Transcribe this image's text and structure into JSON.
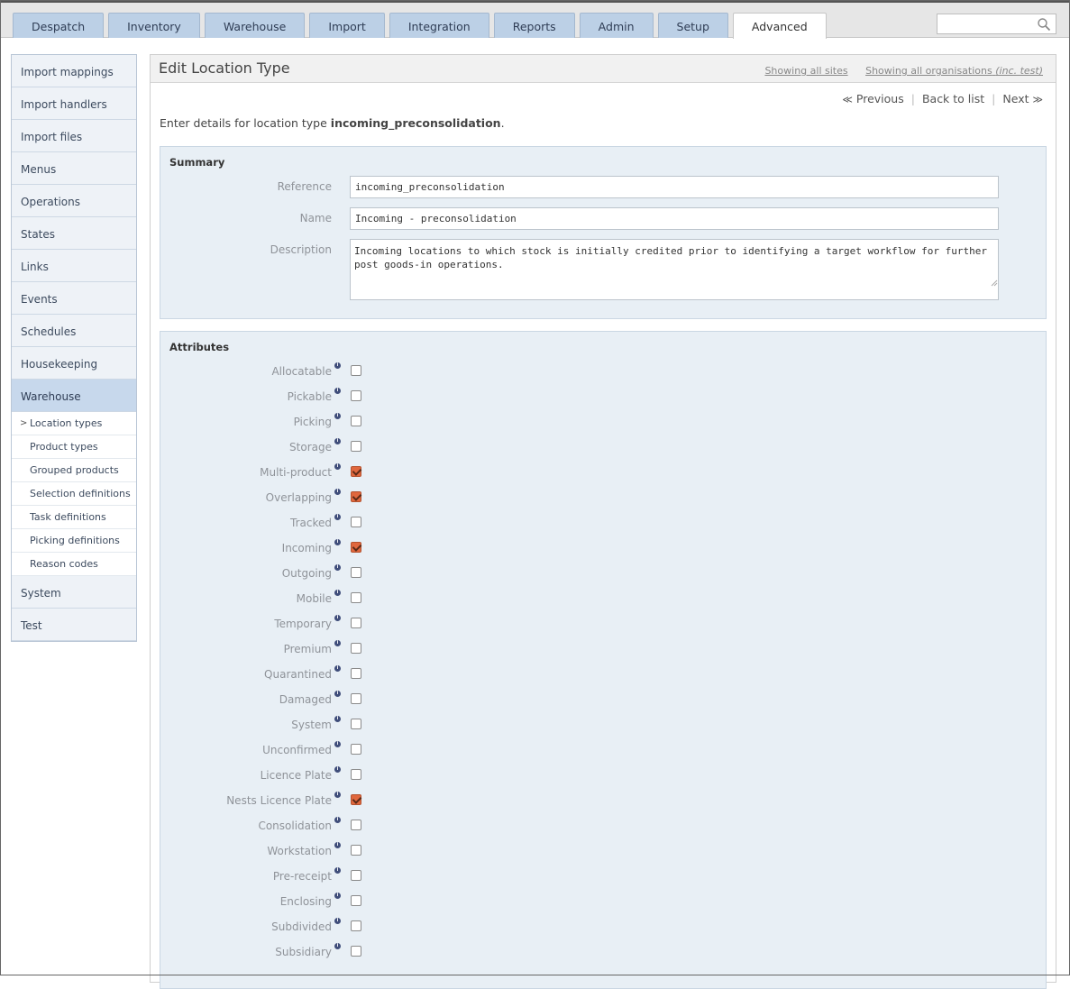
{
  "nav": {
    "tabs": [
      "Despatch",
      "Inventory",
      "Warehouse",
      "Import",
      "Integration",
      "Reports",
      "Admin",
      "Setup",
      "Advanced"
    ],
    "active_tab": "Advanced",
    "search_placeholder": ""
  },
  "sidebar": {
    "items_top": [
      "Import mappings",
      "Import handlers",
      "Import files",
      "Menus",
      "Operations",
      "States",
      "Links",
      "Events",
      "Schedules",
      "Housekeeping",
      "Warehouse"
    ],
    "active_item": "Warehouse",
    "sub_items": [
      "Location types",
      "Product types",
      "Grouped products",
      "Selection definitions",
      "Task definitions",
      "Picking definitions",
      "Reason codes"
    ],
    "active_sub_item": "Location types",
    "current_marker": ">",
    "items_bottom": [
      "System",
      "Test"
    ]
  },
  "main": {
    "title": "Edit Location Type",
    "scope_sites": "Showing all sites",
    "scope_orgs": "Showing all organisations",
    "scope_orgs_note": "(inc. test)",
    "pager": {
      "prev_glyph": "≪",
      "previous": "Previous",
      "back": "Back to list",
      "next": "Next",
      "next_glyph": "≫",
      "separator": "|"
    },
    "intro_prefix": "Enter details for location type ",
    "intro_value": "incoming_preconsolidation",
    "intro_suffix": "."
  },
  "summary": {
    "title": "Summary",
    "reference_label": "Reference",
    "reference_value": "incoming_preconsolidation",
    "name_label": "Name",
    "name_value": "Incoming - preconsolidation",
    "description_label": "Description",
    "description_value": "Incoming locations to which stock is initially credited prior to identifying a target workflow for further post goods-in operations."
  },
  "attributes": {
    "title": "Attributes",
    "info_glyph": "i",
    "items": [
      {
        "label": "Allocatable",
        "checked": false
      },
      {
        "label": "Pickable",
        "checked": false
      },
      {
        "label": "Picking",
        "checked": false
      },
      {
        "label": "Storage",
        "checked": false
      },
      {
        "label": "Multi-product",
        "checked": true
      },
      {
        "label": "Overlapping",
        "checked": true
      },
      {
        "label": "Tracked",
        "checked": false
      },
      {
        "label": "Incoming",
        "checked": true
      },
      {
        "label": "Outgoing",
        "checked": false
      },
      {
        "label": "Mobile",
        "checked": false
      },
      {
        "label": "Temporary",
        "checked": false
      },
      {
        "label": "Premium",
        "checked": false
      },
      {
        "label": "Quarantined",
        "checked": false
      },
      {
        "label": "Damaged",
        "checked": false
      },
      {
        "label": "System",
        "checked": false
      },
      {
        "label": "Unconfirmed",
        "checked": false
      },
      {
        "label": "Licence Plate",
        "checked": false
      },
      {
        "label": "Nests Licence Plate",
        "checked": true
      },
      {
        "label": "Consolidation",
        "checked": false
      },
      {
        "label": "Workstation",
        "checked": false
      },
      {
        "label": "Pre-receipt",
        "checked": false
      },
      {
        "label": "Enclosing",
        "checked": false
      },
      {
        "label": "Subdivided",
        "checked": false
      },
      {
        "label": "Subsidiary",
        "checked": false
      }
    ]
  },
  "colors": {
    "tab_bg": "#bcd0e6",
    "panel_bg": "#e8eff5",
    "checkbox_checked": "#e0673d",
    "sidebar_active": "#c7d8ec"
  }
}
